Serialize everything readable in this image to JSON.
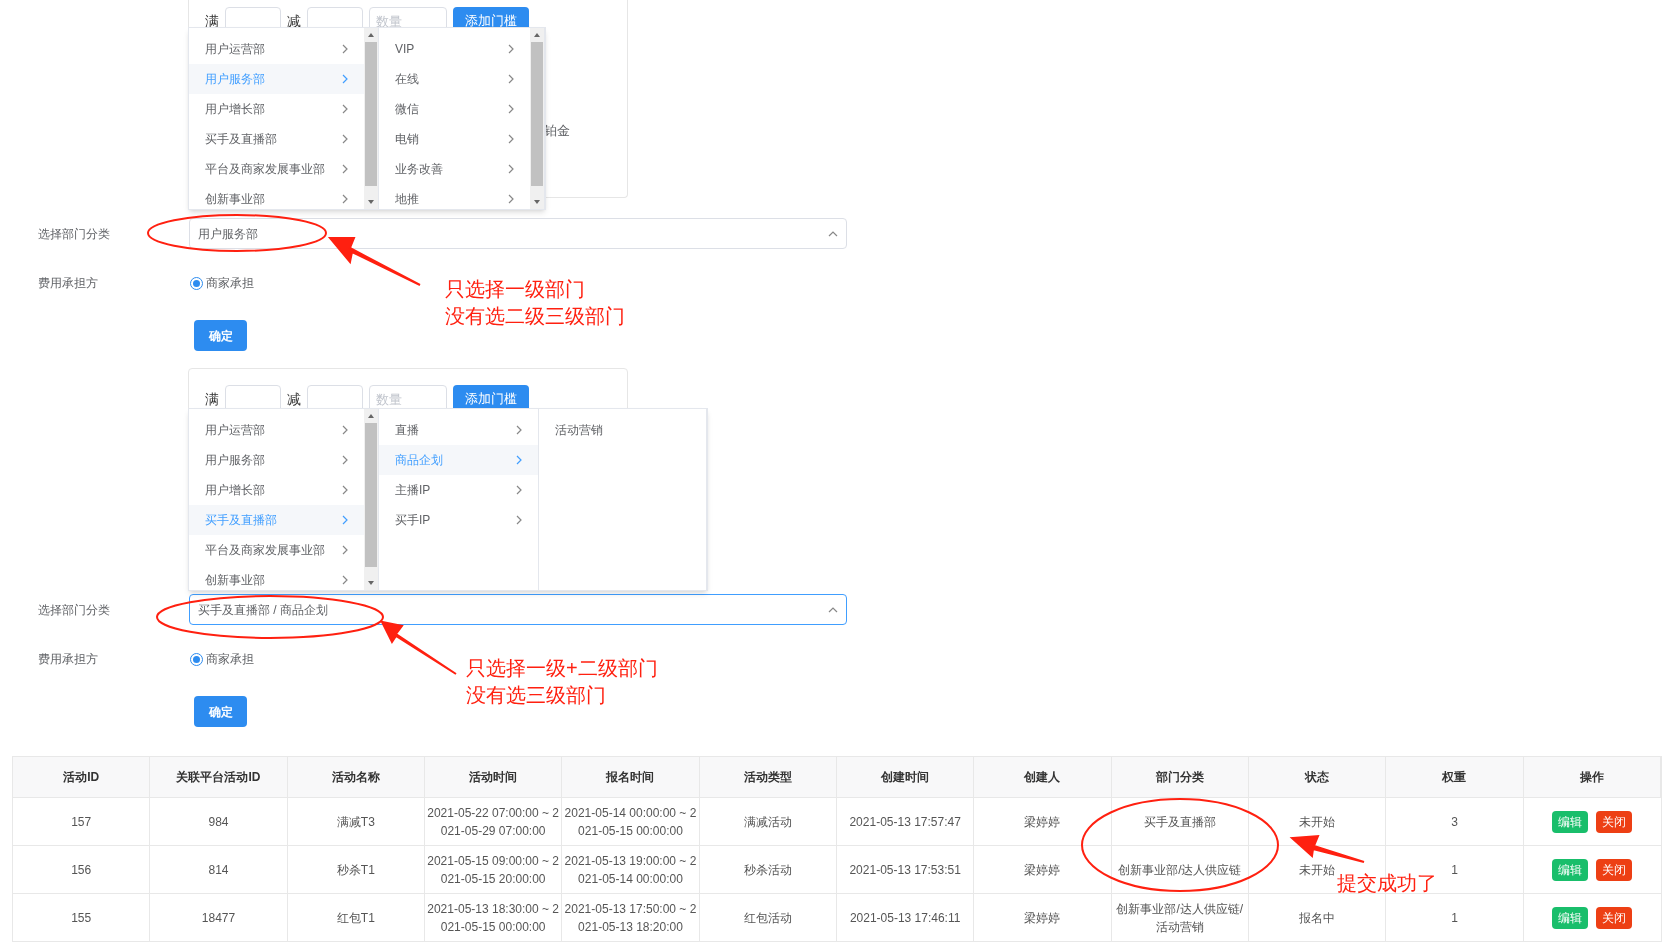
{
  "sections": [
    {
      "card": {
        "full_label": "满",
        "minus_label": "减",
        "quantity_placeholder": "数量",
        "add_button": "添加门槛",
        "extra_text": "铂金"
      },
      "cascader": {
        "columns": [
          {
            "scrollable": true,
            "items": [
              {
                "label": "用户运营部",
                "selected": false,
                "expandable": true
              },
              {
                "label": "用户服务部",
                "selected": true,
                "expandable": true
              },
              {
                "label": "用户增长部",
                "selected": false,
                "expandable": true
              },
              {
                "label": "买手及直播部",
                "selected": false,
                "expandable": true
              },
              {
                "label": "平台及商家发展事业部",
                "selected": false,
                "expandable": true
              },
              {
                "label": "创新事业部",
                "selected": false,
                "expandable": true
              }
            ]
          },
          {
            "scrollable": true,
            "items": [
              {
                "label": "VIP",
                "selected": false,
                "expandable": true
              },
              {
                "label": "在线",
                "selected": false,
                "expandable": true
              },
              {
                "label": "微信",
                "selected": false,
                "expandable": true
              },
              {
                "label": "电销",
                "selected": false,
                "expandable": true
              },
              {
                "label": "业务改善",
                "selected": false,
                "expandable": true
              },
              {
                "label": "地推",
                "selected": false,
                "expandable": true
              }
            ]
          }
        ]
      },
      "department_label": "选择部门分类",
      "department_value": "用户服务部",
      "focused": false,
      "payer_label": "费用承担方",
      "payer_option": {
        "label": "商家承担",
        "selected": true
      },
      "confirm_button": "确定"
    },
    {
      "card": {
        "full_label": "满",
        "minus_label": "减",
        "quantity_placeholder": "数量",
        "add_button": "添加门槛"
      },
      "cascader": {
        "columns": [
          {
            "scrollable": true,
            "items": [
              {
                "label": "用户运营部",
                "selected": false,
                "expandable": true
              },
              {
                "label": "用户服务部",
                "selected": false,
                "expandable": true
              },
              {
                "label": "用户增长部",
                "selected": false,
                "expandable": true
              },
              {
                "label": "买手及直播部",
                "selected": true,
                "expandable": true
              },
              {
                "label": "平台及商家发展事业部",
                "selected": false,
                "expandable": true
              },
              {
                "label": "创新事业部",
                "selected": false,
                "expandable": true
              }
            ]
          },
          {
            "scrollable": false,
            "items": [
              {
                "label": "直播",
                "selected": false,
                "expandable": true
              },
              {
                "label": "商品企划",
                "selected": true,
                "expandable": true
              },
              {
                "label": "主播IP",
                "selected": false,
                "expandable": true
              },
              {
                "label": "买手IP",
                "selected": false,
                "expandable": true
              }
            ]
          },
          {
            "scrollable": false,
            "items": [
              {
                "label": "活动营销",
                "selected": false,
                "expandable": false
              }
            ]
          }
        ]
      },
      "department_label": "选择部门分类",
      "department_value": "买手及直播部 / 商品企划",
      "focused": true,
      "payer_label": "费用承担方",
      "payer_option": {
        "label": "商家承担",
        "selected": true
      },
      "confirm_button": "确定"
    }
  ],
  "table": {
    "columns": [
      "活动ID",
      "关联平台活动ID",
      "活动名称",
      "活动时间",
      "报名时间",
      "活动类型",
      "创建时间",
      "创建人",
      "部门分类",
      "状态",
      "权重",
      "操作"
    ],
    "rows": [
      {
        "cells": [
          "157",
          "984",
          "满减T3",
          "2021-05-22 07:00:00 ~ 2021-05-29 07:00:00",
          "2021-05-14 00:00:00 ~ 2021-05-15 00:00:00",
          "满减活动",
          "2021-05-13 17:57:47",
          "梁婷婷",
          "买手及直播部",
          "未开始",
          "3"
        ],
        "actions": [
          {
            "label": "编辑",
            "kind": "edit"
          },
          {
            "label": "关闭",
            "kind": "close"
          }
        ]
      },
      {
        "cells": [
          "156",
          "814",
          "秒杀T1",
          "2021-05-15 09:00:00 ~ 2021-05-15 20:00:00",
          "2021-05-13 19:00:00 ~ 2021-05-14 00:00:00",
          "秒杀活动",
          "2021-05-13 17:53:51",
          "梁婷婷",
          "创新事业部/达人供应链",
          "未开始",
          "1"
        ],
        "actions": [
          {
            "label": "编辑",
            "kind": "edit"
          },
          {
            "label": "关闭",
            "kind": "close"
          }
        ]
      },
      {
        "cells": [
          "155",
          "18477",
          "红包T1",
          "2021-05-13 18:30:00 ~ 2021-05-15 00:00:00",
          "2021-05-13 17:50:00 ~ 2021-05-13 18:20:00",
          "红包活动",
          "2021-05-13 17:46:11",
          "梁婷婷",
          "创新事业部/达人供应链/活动营销",
          "报名中",
          "1"
        ],
        "actions": [
          {
            "label": "编辑",
            "kind": "edit"
          },
          {
            "label": "关闭",
            "kind": "close"
          }
        ]
      }
    ]
  },
  "annotations": [
    {
      "lines": [
        "只选择一级部门",
        "没有选二级三级部门"
      ]
    },
    {
      "lines": [
        "只选择一级+二级部门",
        "没有选三级部门"
      ]
    },
    {
      "lines": [
        "提交成功了"
      ]
    }
  ]
}
